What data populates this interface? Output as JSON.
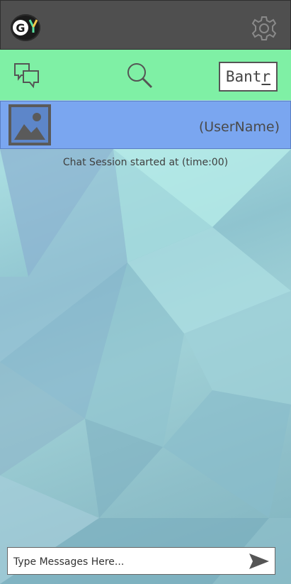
{
  "app": {
    "logo_letter": "G",
    "brand_label_prefix": "Bant",
    "brand_label_underlined": "r"
  },
  "nav": {
    "icons": [
      "chat-bubbles-icon",
      "search-icon"
    ]
  },
  "chat": {
    "username": "(UserName)",
    "session_text": "Chat Session started at (time:00)"
  },
  "composer": {
    "placeholder": "Type Messages Here..."
  },
  "colors": {
    "topbar": "#4f4f4f",
    "navbar": "#7ff0a5",
    "userbar": "#7aa6f0"
  }
}
